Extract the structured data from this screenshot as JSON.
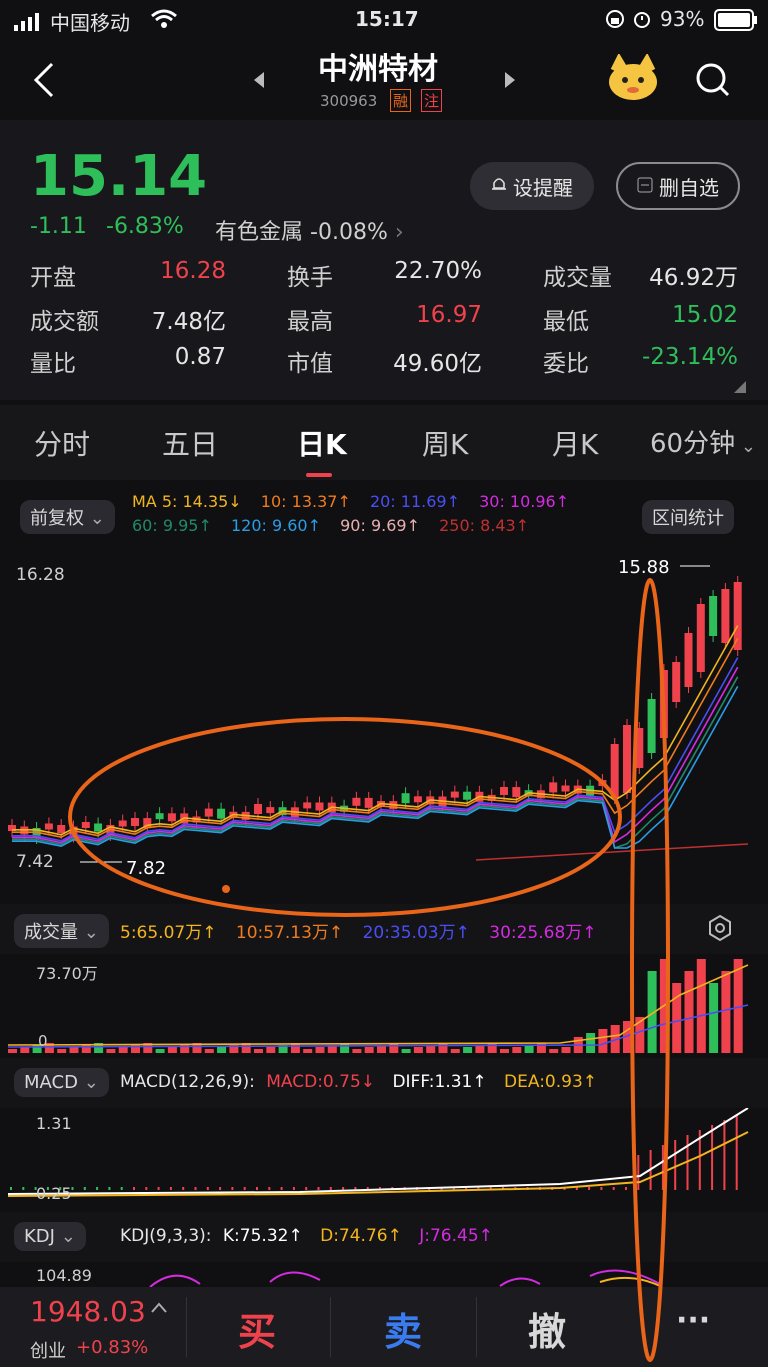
{
  "status": {
    "carrier": "中国移动",
    "time": "15:17",
    "battery": "93%"
  },
  "header": {
    "name": "中洲特材",
    "code": "300963",
    "tag_rong": "融",
    "tag_zhu": "注"
  },
  "quote": {
    "price": "15.14",
    "change": "-1.11",
    "change_pct": "-6.83%",
    "sector": "有色金属",
    "sector_pct": "-0.08%",
    "alert_btn": "设提醒",
    "delete_btn": "删自选",
    "stats": [
      {
        "label": "开盘",
        "value": "16.28",
        "color": "#f0424c"
      },
      {
        "label": "换手",
        "value": "22.70%",
        "color": "#e6e6e6"
      },
      {
        "label": "成交量",
        "value": "46.92万",
        "color": "#e6e6e6"
      },
      {
        "label": "成交额",
        "value": "7.48亿",
        "color": "#e6e6e6"
      },
      {
        "label": "最高",
        "value": "16.97",
        "color": "#f0424c"
      },
      {
        "label": "最低",
        "value": "15.02",
        "color": "#2fbf5a"
      },
      {
        "label": "量比",
        "value": "0.87",
        "color": "#e6e6e6"
      },
      {
        "label": "市值",
        "value": "49.60亿",
        "color": "#e6e6e6"
      },
      {
        "label": "委比",
        "value": "-23.14%",
        "color": "#2fbf5a"
      }
    ]
  },
  "tabs": [
    "分时",
    "五日",
    "日K",
    "周K",
    "月K",
    "60分钟"
  ],
  "kline": {
    "adjust_btn": "前复权",
    "stats_btn": "区间统计",
    "ma_row1": [
      "MA 5: 14.35↓",
      "10: 13.37↑",
      "20: 11.69↑",
      "30: 10.96↑"
    ],
    "ma_row2": [
      "60: 9.95↑",
      "120: 9.60↑",
      "90: 9.69↑",
      "250: 8.43↑"
    ],
    "y_top": "16.28",
    "y_bottom": "7.42",
    "high_label": "15.88",
    "low_label": "7.82"
  },
  "volume": {
    "btn": "成交量",
    "ma": [
      "5:65.07万↑",
      "10:57.13万↑",
      "20:35.03万↑",
      "30:25.68万↑"
    ],
    "y_top": "73.70万",
    "y_zero": "0"
  },
  "macd": {
    "btn": "MACD",
    "params": "MACD(12,26,9):",
    "macd": "MACD:0.75↓",
    "diff": "DIFF:1.31↑",
    "dea": "DEA:0.93↑",
    "y_top": "1.31",
    "y_mid": "0.25"
  },
  "kdj": {
    "btn": "KDJ",
    "params": "KDJ(9,3,3):",
    "k": "K:75.32↑",
    "d": "D:74.76↑",
    "j": "J:76.45↑",
    "y_top": "104.89"
  },
  "bottom": {
    "index_value": "1948.03",
    "index_name": "创业",
    "index_pct": "+0.83%",
    "buy": "买",
    "sell": "卖",
    "cancel": "撤",
    "more": "···"
  },
  "colors": {
    "up": "#f0424c",
    "down": "#2fbf5a",
    "annotation": "#e8651a"
  }
}
